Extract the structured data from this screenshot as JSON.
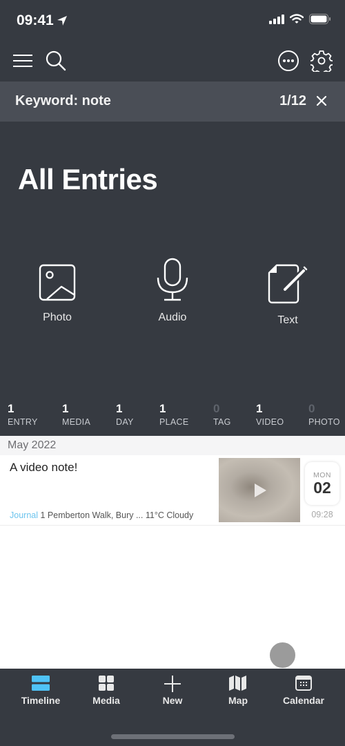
{
  "status_bar": {
    "time": "09:41"
  },
  "toolbar": {
    "menu_icon": "hamburger-menu",
    "search_icon": "magnifying-glass",
    "more_icon": "ellipsis-circle",
    "settings_icon": "gear"
  },
  "search": {
    "keyword_label": "Keyword: note",
    "result_count": "1/12",
    "close_icon": "x-mark"
  },
  "page_title": "All Entries",
  "quick_actions": [
    {
      "label": "Photo",
      "icon": "photo-frame"
    },
    {
      "label": "Audio",
      "icon": "microphone"
    },
    {
      "label": "Text",
      "icon": "document-pencil"
    }
  ],
  "stats": [
    {
      "value": "1",
      "label": "ENTRY"
    },
    {
      "value": "1",
      "label": "MEDIA"
    },
    {
      "value": "1",
      "label": "DAY"
    },
    {
      "value": "1",
      "label": "PLACE"
    },
    {
      "value": "0",
      "label": "TAG"
    },
    {
      "value": "1",
      "label": "VIDEO"
    },
    {
      "value": "0",
      "label": "PHOTO"
    }
  ],
  "timeline": {
    "month": "May 2022",
    "entries": [
      {
        "title": "A video note!",
        "journal": "Journal",
        "location": "1 Pemberton Walk, Bury ...",
        "weather": "11°C Cloudy",
        "day_of_week": "MON",
        "day": "02",
        "time": "09:28"
      }
    ]
  },
  "tabbar": {
    "active": "Timeline",
    "accent_color": "#4fc3f7",
    "tabs": [
      {
        "label": "Timeline",
        "icon": "timeline"
      },
      {
        "label": "Media",
        "icon": "grid"
      },
      {
        "label": "New",
        "icon": "plus"
      },
      {
        "label": "Map",
        "icon": "map"
      },
      {
        "label": "Calendar",
        "icon": "calendar"
      }
    ]
  }
}
